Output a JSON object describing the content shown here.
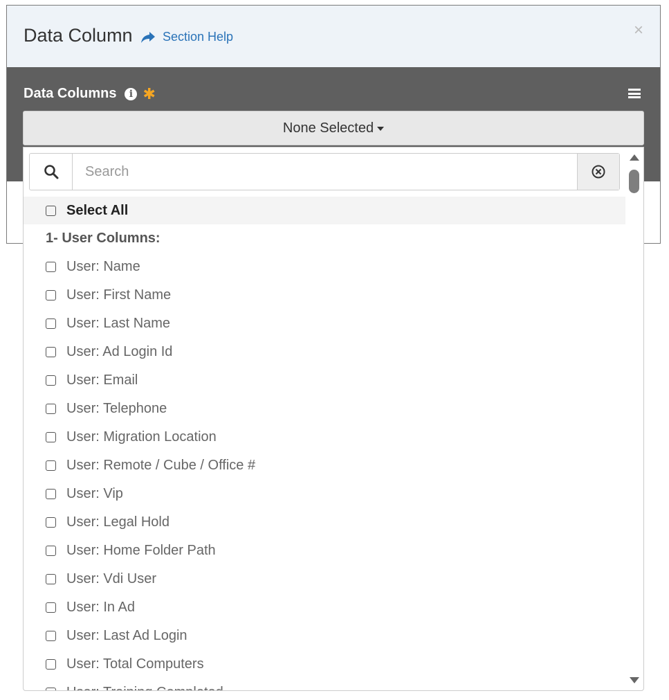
{
  "modal": {
    "title": "Data Column",
    "help_link": "Section Help",
    "close_symbol": "×"
  },
  "panel": {
    "title": "Data Columns",
    "info_symbol": "i",
    "required_symbol": "✱"
  },
  "select": {
    "value": "None Selected"
  },
  "search": {
    "placeholder": "Search"
  },
  "list": {
    "select_all": "Select All",
    "group_label": "1- User Columns:",
    "items": [
      "User: Name",
      "User: First Name",
      "User: Last Name",
      "User: Ad Login Id",
      "User: Email",
      "User: Telephone",
      "User: Migration Location",
      "User: Remote / Cube / Office #",
      "User: Vip",
      "User: Legal Hold",
      "User: Home Folder Path",
      "User: Vdi User",
      "User: In Ad",
      "User: Last Ad Login",
      "User: Total Computers",
      "User: Training Completed"
    ]
  },
  "icons": {
    "search": "search-icon",
    "clear": "clear-circle-icon",
    "help": "share-arrow-icon",
    "menu": "hamburger-icon"
  },
  "colors": {
    "link": "#2a73b8",
    "panel": "#5f5f5f",
    "required": "#f5a623",
    "header": "#eef3f8"
  }
}
